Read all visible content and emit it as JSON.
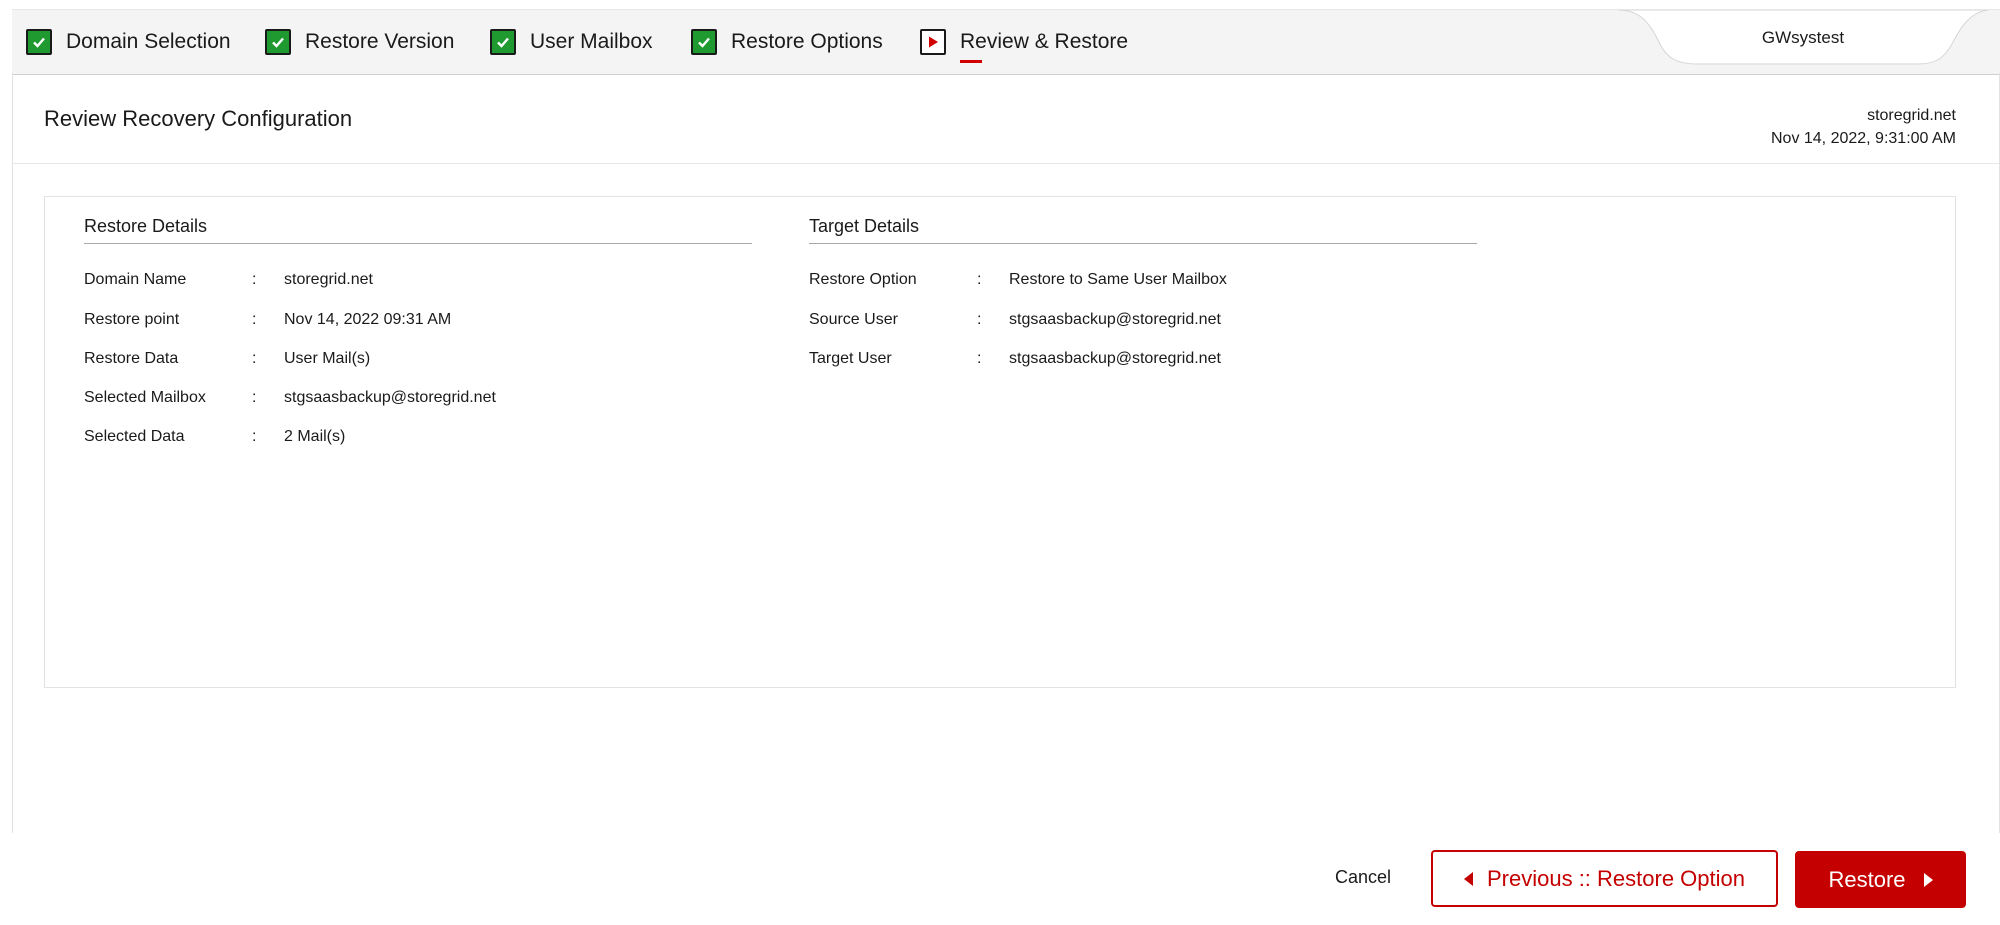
{
  "wizard": {
    "steps": [
      {
        "label": "Domain Selection",
        "state": "complete"
      },
      {
        "label": "Restore Version",
        "state": "complete"
      },
      {
        "label": "User Mailbox",
        "state": "complete"
      },
      {
        "label": "Restore Options",
        "state": "complete"
      },
      {
        "label": "Review & Restore",
        "state": "current"
      }
    ],
    "user_tab": "GWsystest"
  },
  "header": {
    "title": "Review Recovery Configuration",
    "domain": "storegrid.net",
    "timestamp": "Nov 14, 2022, 9:31:00 AM"
  },
  "restore_details": {
    "title": "Restore Details",
    "rows": [
      {
        "label": "Domain Name",
        "value": "storegrid.net"
      },
      {
        "label": "Restore point",
        "value": "Nov 14, 2022 09:31 AM"
      },
      {
        "label": "Restore Data",
        "value": "User Mail(s)"
      },
      {
        "label": "Selected Mailbox",
        "value": "stgsaasbackup@storegrid.net"
      },
      {
        "label": "Selected Data",
        "value": "2 Mail(s)"
      }
    ]
  },
  "target_details": {
    "title": "Target Details",
    "rows": [
      {
        "label": "Restore Option",
        "value": "Restore to Same User Mailbox"
      },
      {
        "label": "Source User",
        "value": "stgsaasbackup@storegrid.net"
      },
      {
        "label": "Target User",
        "value": "stgsaasbackup@storegrid.net"
      }
    ]
  },
  "separator": ":",
  "footer": {
    "cancel": "Cancel",
    "previous": "Previous :: Restore Option",
    "restore": "Restore"
  },
  "colors": {
    "accent": "#c40000",
    "check_green": "#1e9a31"
  }
}
